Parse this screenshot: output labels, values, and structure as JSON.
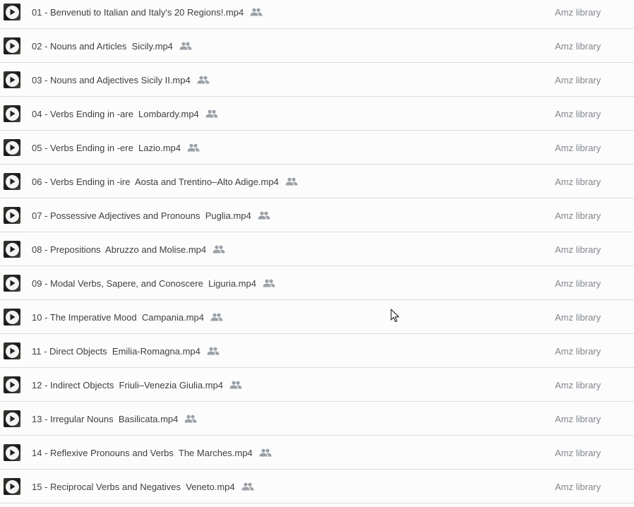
{
  "files": [
    {
      "name": "01 - Benvenuti to Italian and Italy's 20 Regions!.mp4",
      "owner": "Amz library"
    },
    {
      "name": "02 - Nouns and Articles  Sicily.mp4",
      "owner": "Amz library"
    },
    {
      "name": "03 - Nouns and Adjectives Sicily II.mp4",
      "owner": "Amz library"
    },
    {
      "name": "04 - Verbs Ending in -are  Lombardy.mp4",
      "owner": "Amz library"
    },
    {
      "name": "05 - Verbs Ending in -ere  Lazio.mp4",
      "owner": "Amz library"
    },
    {
      "name": "06 - Verbs Ending in -ire  Aosta and Trentino–Alto Adige.mp4",
      "owner": "Amz library"
    },
    {
      "name": "07 - Possessive Adjectives and Pronouns  Puglia.mp4",
      "owner": "Amz library"
    },
    {
      "name": "08 - Prepositions  Abruzzo and Molise.mp4",
      "owner": "Amz library"
    },
    {
      "name": "09 - Modal Verbs, Sapere, and Conoscere  Liguria.mp4",
      "owner": "Amz library"
    },
    {
      "name": "10 - The Imperative Mood  Campania.mp4",
      "owner": "Amz library"
    },
    {
      "name": "11 - Direct Objects  Emilia-Romagna.mp4",
      "owner": "Amz library"
    },
    {
      "name": "12 - Indirect Objects  Friuli–Venezia Giulia.mp4",
      "owner": "Amz library"
    },
    {
      "name": "13 - Irregular Nouns  Basilicata.mp4",
      "owner": "Amz library"
    },
    {
      "name": "14 - Reflexive Pronouns and Verbs  The Marches.mp4",
      "owner": "Amz library"
    },
    {
      "name": "15 - Reciprocal Verbs and Negatives  Veneto.mp4",
      "owner": "Amz library"
    }
  ],
  "icons": {
    "thumbnail": "video-play-icon",
    "shared": "shared-people-icon",
    "cursor": "mouse-pointer-icon"
  },
  "colors": {
    "text": "#3c4043",
    "owner_text": "#80868b",
    "divider": "#dadce0",
    "shared_icon": "#9aa0a6"
  }
}
